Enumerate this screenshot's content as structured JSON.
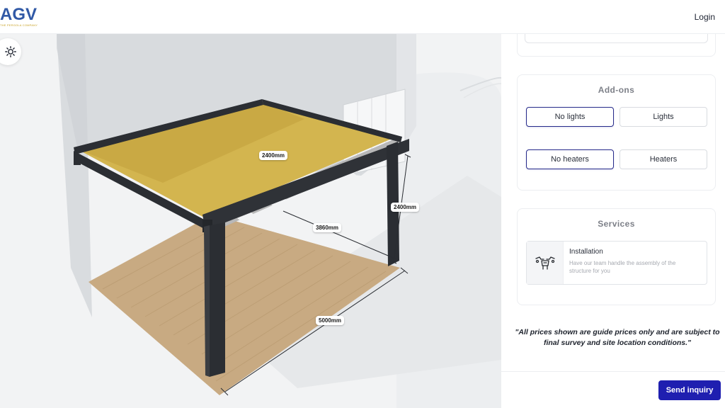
{
  "header": {
    "logo_text": "AGV",
    "logo_tagline": "THE PERGOLA COMPANY",
    "login_label": "Login"
  },
  "viewer": {
    "light_toggle_icon": "sun-icon",
    "dimensions": {
      "roof_width": "2400mm",
      "height": "2400mm",
      "depth": "3860mm",
      "length": "5000mm"
    }
  },
  "addons": {
    "title": "Add-ons",
    "lights": {
      "options": [
        "No lights",
        "Lights"
      ],
      "selected": "No lights"
    },
    "heaters": {
      "options": [
        "No heaters",
        "Heaters"
      ],
      "selected": "No heaters"
    }
  },
  "services": {
    "title": "Services",
    "items": [
      {
        "icon": "tools-icon",
        "title": "Installation",
        "description": "Have our team handle the assembly of the structure for you"
      }
    ]
  },
  "disclaimer": "\"All prices shown are guide prices only and are subject to final survey and site location conditions.\"",
  "footer": {
    "send_label": "Send inquiry"
  },
  "colors": {
    "accent": "#1f1fb0",
    "selected_border": "#262a8a",
    "logo_blue": "#3159a6",
    "canopy": "#d3b54f",
    "frame": "#2b2e33"
  }
}
